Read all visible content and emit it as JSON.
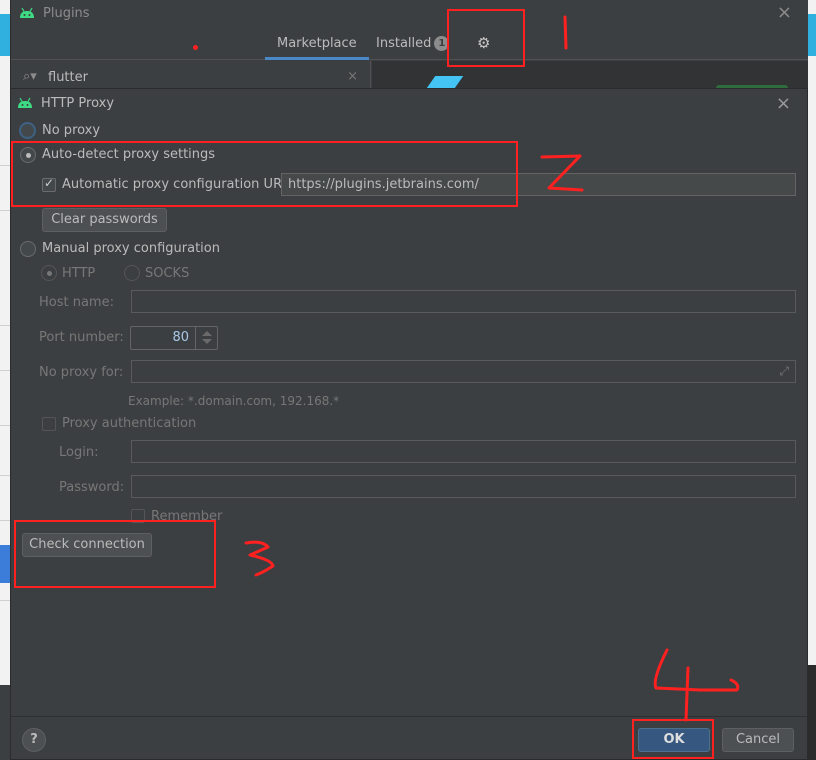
{
  "plugins_window": {
    "title": "Plugins",
    "tabs": [
      {
        "label": "Marketplace",
        "active": true
      },
      {
        "label": "Installed",
        "badge": "1",
        "active": false
      }
    ],
    "settings_icon": "gear-icon",
    "search": {
      "value": "flutter",
      "icon": "search-icon"
    },
    "close_label": "×"
  },
  "proxy_dialog": {
    "title": "HTTP Proxy",
    "close_label": "×",
    "no_proxy": {
      "label": "No proxy",
      "checked": false
    },
    "auto_detect": {
      "label": "Auto-detect proxy settings",
      "checked": true
    },
    "auto_config_url": {
      "label": "Automatic proxy configuration URL:",
      "checked": true,
      "value": "https://plugins.jetbrains.com/"
    },
    "clear_passwords_label": "Clear passwords",
    "manual": {
      "label": "Manual proxy configuration",
      "checked": false
    },
    "protocol": {
      "http_label": "HTTP",
      "socks_label": "SOCKS",
      "selected": "HTTP"
    },
    "host_name": {
      "label": "Host name:",
      "value": ""
    },
    "port_number": {
      "label": "Port number:",
      "value": "80"
    },
    "no_proxy_for": {
      "label": "No proxy for:",
      "value": "",
      "example": "Example: *.domain.com, 192.168.*"
    },
    "proxy_auth": {
      "label": "Proxy authentication",
      "checked": false
    },
    "login": {
      "label": "Login:",
      "value": ""
    },
    "password": {
      "label": "Password:",
      "value": ""
    },
    "remember": {
      "label": "Remember",
      "checked": false
    },
    "check_connection_label": "Check connection",
    "help_label": "?",
    "ok_label": "OK",
    "cancel_label": "Cancel"
  },
  "annotations": {
    "step1": "1",
    "step2": "2",
    "step3": "3",
    "step4": "4",
    "color": "#ff2020"
  }
}
